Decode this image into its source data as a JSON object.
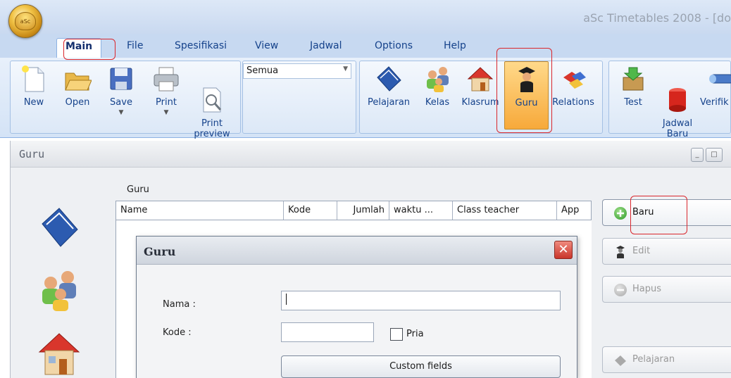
{
  "app": {
    "window_title": "aSc Timetables 2008  - [do",
    "orb_label": "aSc"
  },
  "tabs": [
    {
      "label": "Main",
      "active": true
    },
    {
      "label": "File"
    },
    {
      "label": "Spesifikasi"
    },
    {
      "label": "View"
    },
    {
      "label": "Jadwal"
    },
    {
      "label": "Options"
    },
    {
      "label": "Help"
    }
  ],
  "ribbon": {
    "file_group": [
      {
        "label": "New",
        "icon": "new-document-icon"
      },
      {
        "label": "Open",
        "icon": "open-folder-icon"
      },
      {
        "label": "Save",
        "icon": "save-disk-icon",
        "has_dropdown": true
      },
      {
        "label": "Print",
        "icon": "printer-icon",
        "has_dropdown": true
      },
      {
        "label": "Print\npreview",
        "icon": "print-preview-icon"
      }
    ],
    "filter_combo": {
      "value": "Semua"
    },
    "data_group": [
      {
        "label": "Pelajaran",
        "icon": "book-icon"
      },
      {
        "label": "Kelas",
        "icon": "people-icon"
      },
      {
        "label": "Klasrum",
        "icon": "house-icon"
      },
      {
        "label": "Guru",
        "icon": "teacher-icon",
        "selected": true
      },
      {
        "label": "Relations",
        "icon": "relations-icon"
      }
    ],
    "schedule_group": [
      {
        "label": "Test",
        "icon": "test-icon"
      },
      {
        "label": "Jadwal\nBaru",
        "icon": "new-schedule-icon"
      },
      {
        "label": "Verifik",
        "icon": "verify-icon"
      }
    ]
  },
  "guru_window": {
    "title": "Guru",
    "list_caption": "Guru",
    "columns": [
      "Name",
      "Kode",
      "Jumlah",
      "waktu ...",
      "Class teacher",
      "App"
    ],
    "actions": [
      {
        "label": "Baru",
        "enabled": true,
        "icon": "add-icon"
      },
      {
        "label": "Edit",
        "enabled": false,
        "icon": "teacher-small-icon"
      },
      {
        "label": "Hapus",
        "enabled": false,
        "icon": "remove-icon"
      },
      {
        "label": "Pelajaran",
        "enabled": false,
        "icon": "book-small-icon"
      }
    ]
  },
  "dialog": {
    "title": "Guru",
    "nama_label": "Nama :",
    "nama_value": "",
    "kode_label": "Kode :",
    "kode_value": "",
    "pria_label": "Pria",
    "pria_checked": false,
    "custom_fields_label": "Custom fields"
  },
  "colors": {
    "ribbon_text": "#15428b",
    "highlight": "#d9262c",
    "selected_bg": "#f7a93a"
  }
}
